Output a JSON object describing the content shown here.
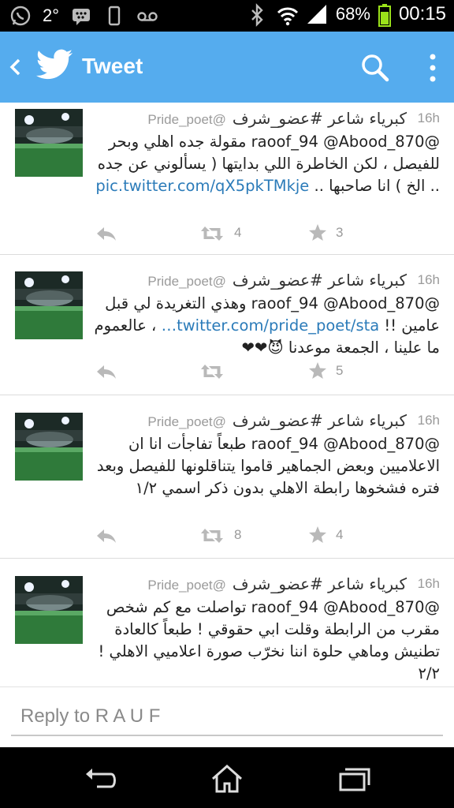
{
  "status_bar": {
    "icons_left": [
      "whatsapp-icon",
      "bbm-icon",
      "phone-icon",
      "voicemail-icon"
    ],
    "temperature": "2°",
    "icons_right": [
      "bluetooth-icon",
      "wifi-icon",
      "signal-icon",
      "battery-icon"
    ],
    "battery": "68%",
    "time": "00:15"
  },
  "action_bar": {
    "title": "Tweet",
    "background": "#55acee",
    "icons": [
      "back-icon",
      "twitter-bird-icon",
      "search-icon",
      "overflow-menu-icon"
    ]
  },
  "tweets": [
    {
      "name": "كبرياء شاعر #عضو_شرف",
      "handle": "@Pride_poet",
      "time": "16h",
      "text": "@raoof_94 @Abood_870 مقولة جده اهلي وبحر للفيصل ، لكن الخاطرة اللي بدايتها ( يسألوني عن جده .. الخ ) انا صاحبها .. ",
      "link": "pic.twitter.com/qX5pkTMkje",
      "text_after": "",
      "retweets": "4",
      "favorites": "3"
    },
    {
      "name": "كبرياء شاعر #عضو_شرف",
      "handle": "@Pride_poet",
      "time": "16h",
      "text": "@raoof_94 @Abood_870 وهذي التغريدة لي قبل عامين !! ",
      "link": "twitter.com/pride_poet/sta…",
      "text_after": " ، عالعموم ما علينا ، الجمعة موعدنا 😈❤❤",
      "retweets": "",
      "favorites": "5"
    },
    {
      "name": "كبرياء شاعر #عضو_شرف",
      "handle": "@Pride_poet",
      "time": "16h",
      "text": "@raoof_94 @Abood_870 طبعاً تفاجأت انا ان الاعلاميين وبعض الجماهير قاموا يتناقلونها للفيصل وبعد فتره فشخوها رابطة الاهلي بدون ذكر اسمي ١/٢",
      "link": "",
      "text_after": "",
      "retweets": "8",
      "favorites": "4"
    },
    {
      "name": "كبرياء شاعر #عضو_شرف",
      "handle": "@Pride_poet",
      "time": "16h",
      "text": "@raoof_94 @Abood_870 تواصلت مع كم شخص مقرب من الرابطة وقلت ابي حقوقي ! طبعاً كالعادة تطنيش وماهي حلوة اننا نخرّب صورة اعلاميي الاهلي ! ٢/٢",
      "link": "",
      "text_after": "",
      "retweets": "",
      "favorites": ""
    }
  ],
  "reply": {
    "placeholder": "Reply to R A U F"
  },
  "nav_bar": {
    "icons": [
      "nav-back-icon",
      "nav-home-icon",
      "nav-recents-icon"
    ]
  }
}
